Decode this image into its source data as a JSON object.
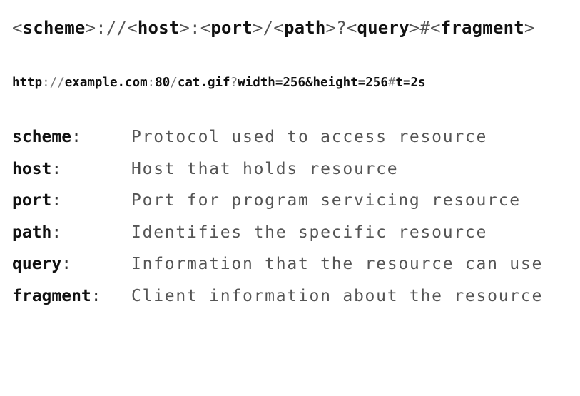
{
  "template": {
    "parts": [
      "<",
      "scheme",
      ">://<",
      "host",
      ">:<",
      "port",
      ">/<",
      "path",
      ">?<",
      "query",
      ">#<",
      "fragment",
      ">"
    ]
  },
  "example": {
    "scheme": "http",
    "sep1": "://",
    "host": "example.com",
    "sep2": ":",
    "port": "80",
    "sep3": "/",
    "path": "cat.gif",
    "sep4": "?",
    "query": "width=256&height=256",
    "sep5": "#",
    "fragment": "t=2s"
  },
  "definitions": [
    {
      "term": "scheme",
      "colon": ":",
      "desc": "Protocol used to access resource"
    },
    {
      "term": "host",
      "colon": ":",
      "desc": "Host that holds resource"
    },
    {
      "term": "port",
      "colon": ":",
      "desc": "Port for program servicing resource"
    },
    {
      "term": "path",
      "colon": ":",
      "desc": "Identifies the specific resource"
    },
    {
      "term": "query",
      "colon": ":",
      "desc": "Information that the resource can use"
    },
    {
      "term": "fragment",
      "colon": ":",
      "desc": "Client information about the resource"
    }
  ]
}
